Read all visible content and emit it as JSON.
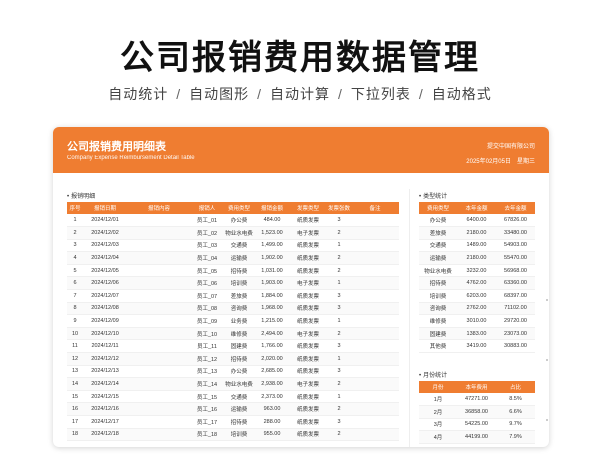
{
  "headline": "公司报销费用数据管理",
  "features": [
    "自动统计",
    "自动图形",
    "自动计算",
    "下拉列表",
    "自动格式"
  ],
  "feature_sep": "/",
  "card": {
    "title": "公司报销费用明细表",
    "subtitle": "Company Expense Reimbursement Detail Table",
    "company": "提交中国有限公司",
    "date": "2025年02月05日",
    "weekday": "星期三"
  },
  "detail": {
    "label": "报销明细",
    "headers": [
      "序号",
      "报销日期",
      "报销内容",
      "报销人",
      "费用类型",
      "报销金额",
      "发票类型",
      "发票张数",
      "备注"
    ],
    "rows": [
      [
        "1",
        "2024/12/01",
        "",
        "员工_01",
        "办公费",
        "484.00",
        "纸质发票",
        "3",
        ""
      ],
      [
        "2",
        "2024/12/02",
        "",
        "员工_02",
        "物业水电费",
        "1,523.00",
        "电子发票",
        "2",
        ""
      ],
      [
        "3",
        "2024/12/03",
        "",
        "员工_03",
        "交通费",
        "1,499.00",
        "纸质发票",
        "1",
        ""
      ],
      [
        "4",
        "2024/12/04",
        "",
        "员工_04",
        "运输费",
        "1,902.00",
        "纸质发票",
        "2",
        ""
      ],
      [
        "5",
        "2024/12/05",
        "",
        "员工_05",
        "招待费",
        "1,031.00",
        "纸质发票",
        "2",
        ""
      ],
      [
        "6",
        "2024/12/06",
        "",
        "员工_06",
        "培训费",
        "1,903.00",
        "电子发票",
        "1",
        ""
      ],
      [
        "7",
        "2024/12/07",
        "",
        "员工_07",
        "差旅费",
        "1,884.00",
        "纸质发票",
        "3",
        ""
      ],
      [
        "8",
        "2024/12/08",
        "",
        "员工_08",
        "咨询费",
        "1,968.00",
        "纸质发票",
        "3",
        ""
      ],
      [
        "9",
        "2024/12/09",
        "",
        "员工_09",
        "业务费",
        "1,215.00",
        "纸质发票",
        "1",
        ""
      ],
      [
        "10",
        "2024/12/10",
        "",
        "员工_10",
        "维修费",
        "2,494.00",
        "电子发票",
        "2",
        ""
      ],
      [
        "11",
        "2024/12/11",
        "",
        "员工_11",
        "固建费",
        "1,766.00",
        "纸质发票",
        "3",
        ""
      ],
      [
        "12",
        "2024/12/12",
        "",
        "员工_12",
        "招待费",
        "2,020.00",
        "纸质发票",
        "1",
        ""
      ],
      [
        "13",
        "2024/12/13",
        "",
        "员工_13",
        "办公费",
        "2,685.00",
        "纸质发票",
        "3",
        ""
      ],
      [
        "14",
        "2024/12/14",
        "",
        "员工_14",
        "物业水电费",
        "2,938.00",
        "电子发票",
        "2",
        ""
      ],
      [
        "15",
        "2024/12/15",
        "",
        "员工_15",
        "交通费",
        "2,373.00",
        "纸质发票",
        "1",
        ""
      ],
      [
        "16",
        "2024/12/16",
        "",
        "员工_16",
        "运输费",
        "963.00",
        "纸质发票",
        "2",
        ""
      ],
      [
        "17",
        "2024/12/17",
        "",
        "员工_17",
        "招待费",
        "288.00",
        "纸质发票",
        "3",
        ""
      ],
      [
        "18",
        "2024/12/18",
        "",
        "员工_18",
        "培训费",
        "955.00",
        "纸质发票",
        "2",
        ""
      ]
    ]
  },
  "type_stats": {
    "label": "类型统计",
    "headers": [
      "费用类型",
      "本年金额",
      "去年金额"
    ],
    "rows": [
      [
        "办公费",
        "6400.00",
        "67826.00"
      ],
      [
        "差旅费",
        "2180.00",
        "33480.00"
      ],
      [
        "交通费",
        "1489.00",
        "54903.00"
      ],
      [
        "运输费",
        "2180.00",
        "55470.00"
      ],
      [
        "物业水电费",
        "3232.00",
        "56968.00"
      ],
      [
        "招待费",
        "4762.00",
        "63360.00"
      ],
      [
        "培训费",
        "6203.00",
        "68397.00"
      ],
      [
        "咨询费",
        "2762.00",
        "71102.00"
      ],
      [
        "维修费",
        "3010.00",
        "29720.00"
      ],
      [
        "固建费",
        "1383.00",
        "23073.00"
      ],
      [
        "其他费",
        "3419.00",
        "30883.00"
      ]
    ]
  },
  "month_stats": {
    "label": "月份统计",
    "headers": [
      "月份",
      "本年费用",
      "占比"
    ],
    "rows": [
      [
        "1月",
        "47271.00",
        "8.5%"
      ],
      [
        "2月",
        "36858.00",
        "6.6%"
      ],
      [
        "3月",
        "54225.00",
        "9.7%"
      ],
      [
        "4月",
        "44199.00",
        "7.9%"
      ]
    ]
  }
}
